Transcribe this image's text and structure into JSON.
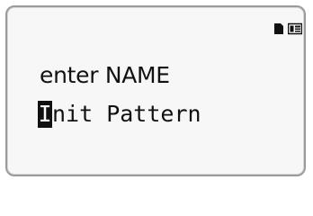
{
  "screen": {
    "prompt": "enter NAME",
    "name_field": {
      "cursor_char": "I",
      "rest": "nit Pattern"
    }
  },
  "status_icons": [
    "pattern-icon",
    "memory-card-icon"
  ],
  "colors": {
    "text": "#111111",
    "lcd_bg": "#fbfbfb",
    "frame": "#9a9a9a"
  }
}
